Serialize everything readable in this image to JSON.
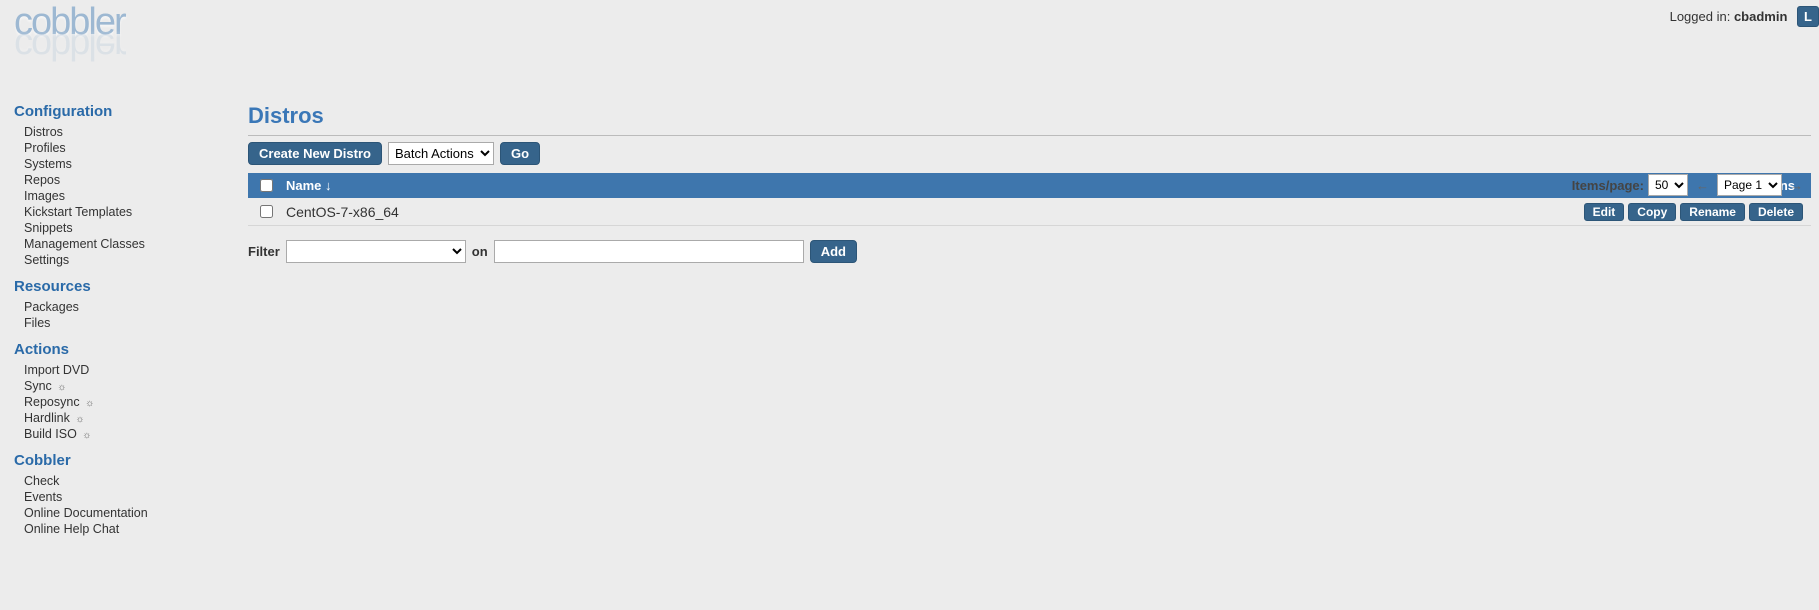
{
  "header": {
    "logged_in_label": "Logged in:",
    "username": "cbadmin",
    "logout_label": "L",
    "logo_text": "cobbler"
  },
  "sidebar": {
    "sections": [
      {
        "title": "Configuration",
        "items": [
          {
            "label": "Distros",
            "gear": false
          },
          {
            "label": "Profiles",
            "gear": false
          },
          {
            "label": "Systems",
            "gear": false
          },
          {
            "label": "Repos",
            "gear": false
          },
          {
            "label": "Images",
            "gear": false
          },
          {
            "label": "Kickstart Templates",
            "gear": false
          },
          {
            "label": "Snippets",
            "gear": false
          },
          {
            "label": "Management Classes",
            "gear": false
          },
          {
            "label": "Settings",
            "gear": false
          }
        ]
      },
      {
        "title": "Resources",
        "items": [
          {
            "label": "Packages",
            "gear": false
          },
          {
            "label": "Files",
            "gear": false
          }
        ]
      },
      {
        "title": "Actions",
        "items": [
          {
            "label": "Import DVD",
            "gear": false
          },
          {
            "label": "Sync",
            "gear": true
          },
          {
            "label": "Reposync",
            "gear": true
          },
          {
            "label": "Hardlink",
            "gear": true
          },
          {
            "label": "Build ISO",
            "gear": true
          }
        ]
      },
      {
        "title": "Cobbler",
        "items": [
          {
            "label": "Check",
            "gear": false
          },
          {
            "label": "Events",
            "gear": false
          },
          {
            "label": "Online Documentation",
            "gear": false
          },
          {
            "label": "Online Help Chat",
            "gear": false
          }
        ]
      }
    ]
  },
  "main": {
    "page_title": "Distros",
    "create_label": "Create New Distro",
    "batch_actions_label": "Batch Actions",
    "go_label": "Go",
    "table": {
      "columns": {
        "name": "Name ↓",
        "actions": "Actions"
      },
      "rows": [
        {
          "name": "CentOS-7-x86_64",
          "actions": [
            "Edit",
            "Copy",
            "Rename",
            "Delete"
          ]
        }
      ]
    },
    "pager": {
      "items_per_page_label": "Items/page:",
      "items_per_page_value": "50",
      "page_value": "Page 1",
      "prev": "←",
      "next": "→"
    },
    "filter": {
      "label": "Filter",
      "on_label": "on",
      "add_label": "Add",
      "select_value": "",
      "text_value": ""
    }
  }
}
